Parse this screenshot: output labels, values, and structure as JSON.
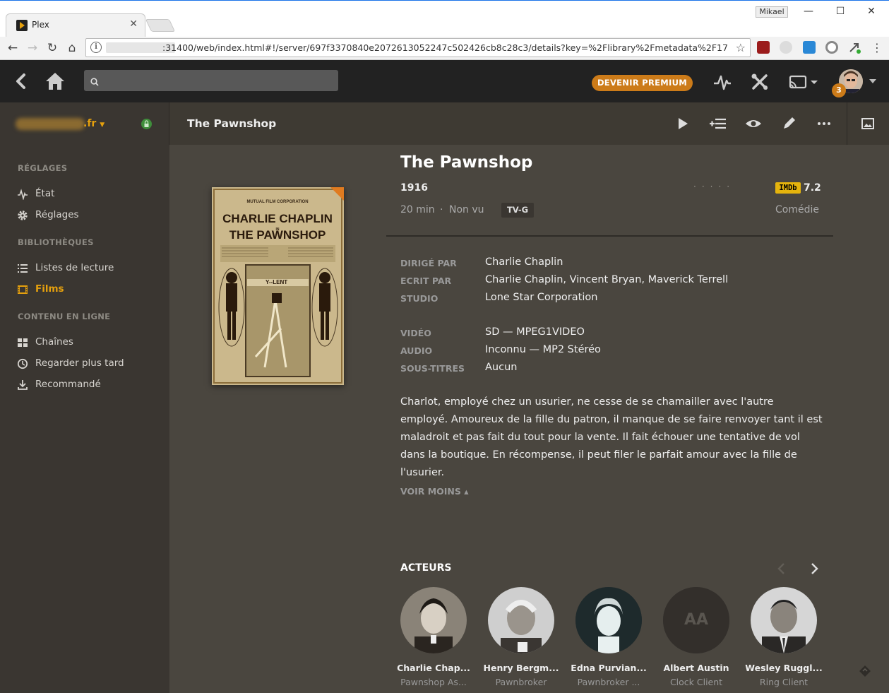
{
  "browser": {
    "tab_title": "Plex",
    "url_tail": ":31400/web/index.html#!/server/697f3370840e2072613052247c502426cb8c28c3/details?key=%2Flibrary%2Fmetadata%2F17",
    "window_user": "Mikael"
  },
  "topbar": {
    "premium_label": "DEVENIR PREMIUM",
    "notifications": "3"
  },
  "server": {
    "name_suffix": ".fr"
  },
  "header": {
    "title": "The Pawnshop"
  },
  "sidebar": {
    "sections": [
      {
        "title": "RÉGLAGES"
      },
      {
        "title": "BIBLIOTHÈQUES"
      },
      {
        "title": "CONTENU EN LIGNE"
      }
    ],
    "items": [
      {
        "label": "État",
        "icon": "activity-icon"
      },
      {
        "label": "Réglages",
        "icon": "gear-icon"
      },
      {
        "label": "Listes de lecture",
        "icon": "list-icon"
      },
      {
        "label": "Films",
        "icon": "film-icon"
      },
      {
        "label": "Chaînes",
        "icon": "grid-icon"
      },
      {
        "label": "Regarder plus tard",
        "icon": "clock-icon"
      },
      {
        "label": "Recommandé",
        "icon": "download-icon"
      }
    ]
  },
  "movie": {
    "title": "The Pawnshop",
    "year": "1916",
    "duration": "20 min",
    "separator": "·",
    "watch_status": "Non vu",
    "content_rating": "TV-G",
    "imdb_label": "IMDb",
    "imdb_rating": "7.2",
    "genre": "Comédie",
    "poster": {
      "line1": "MUTUAL FILM CORPORATION",
      "line2": "CHARLIE CHAPLIN",
      "line3": "IN",
      "line4": "THE PAWNSHOP",
      "sign": "Y--LENT"
    },
    "details": [
      {
        "label": "DIRIGÉ PAR",
        "value": "Charlie Chaplin"
      },
      {
        "label": "ECRIT PAR",
        "value": "Charlie Chaplin, Vincent Bryan, Maverick Terrell"
      },
      {
        "label": "STUDIO",
        "value": "Lone Star Corporation"
      },
      {
        "label": "VIDÉO",
        "value": "SD — MPEG1VIDEO"
      },
      {
        "label": "AUDIO",
        "value": "Inconnu — MP2 Stéréo"
      },
      {
        "label": "SOUS-TITRES",
        "value": "Aucun"
      }
    ],
    "summary": "Charlot, employé chez un usurier, ne cesse de se chamailler avec l'autre employé. Amoureux de la fille du patron, il manque de se faire renvoyer tant il est maladroit et pas fait du tout pour la vente. Il fait échouer une tentative de vol dans la boutique. En récompense, il peut filer le parfait amour avec la fille de l'usurier.",
    "less_label": "VOIR MOINS ▴"
  },
  "cast": {
    "title": "ACTEURS",
    "members": [
      {
        "name": "Charlie Chap...",
        "role": "Pawnshop As..."
      },
      {
        "name": "Henry Bergm...",
        "role": "Pawnbroker"
      },
      {
        "name": "Edna Purvian...",
        "role": "Pawnbroker ..."
      },
      {
        "name": "Albert Austin",
        "role": "Clock Client",
        "initials": "AA"
      },
      {
        "name": "Wesley Ruggl...",
        "role": "Ring Client"
      }
    ]
  }
}
